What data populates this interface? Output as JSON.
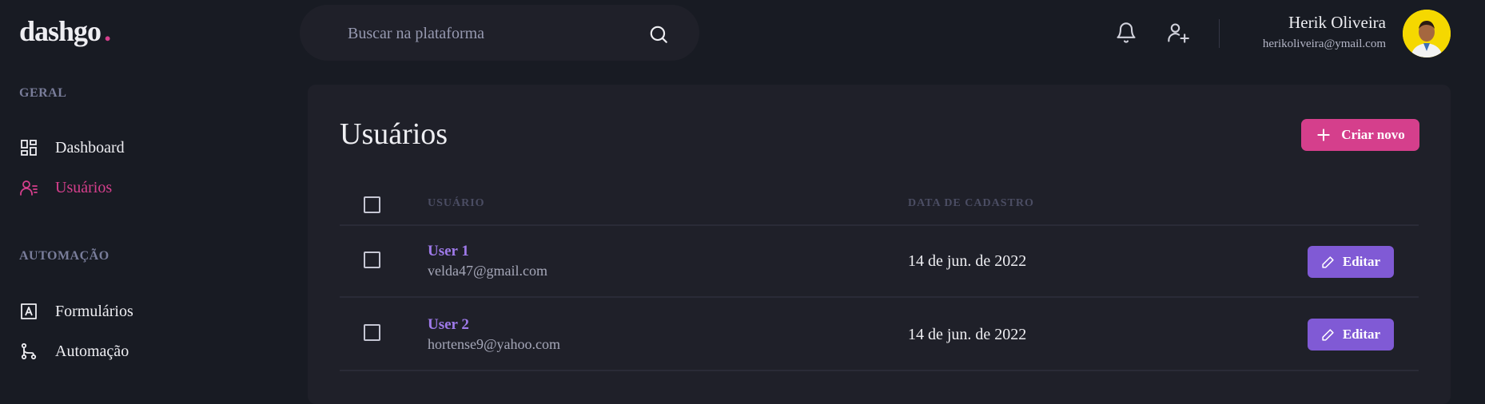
{
  "logo": {
    "text": "dashgo",
    "dot": "."
  },
  "search": {
    "placeholder": "Buscar na plataforma",
    "icon": "search-icon"
  },
  "header": {
    "icons": [
      "bell-icon",
      "user-add-icon"
    ],
    "user": {
      "name": "Herik Oliveira",
      "email": "herikoliveira@ymail.com"
    }
  },
  "sidebar": {
    "sections": [
      {
        "title": "GERAL",
        "items": [
          {
            "label": "Dashboard",
            "icon": "dashboard-icon",
            "active": false
          },
          {
            "label": "Usuários",
            "icon": "users-icon",
            "active": true
          }
        ]
      },
      {
        "title": "AUTOMAÇÃO",
        "items": [
          {
            "label": "Formulários",
            "icon": "form-icon",
            "active": false
          },
          {
            "label": "Automação",
            "icon": "git-branch-icon",
            "active": false
          }
        ]
      }
    ]
  },
  "main": {
    "title": "Usuários",
    "create_button": "Criar novo",
    "columns": [
      "USUÁRIO",
      "DATA DE CADASTRO"
    ],
    "rows": [
      {
        "name": "User 1",
        "email": "velda47@gmail.com",
        "date": "14 de jun. de 2022",
        "action": "Editar"
      },
      {
        "name": "User 2",
        "email": "hortense9@yahoo.com",
        "date": "14 de jun. de 2022",
        "action": "Editar"
      }
    ]
  },
  "colors": {
    "background": "#181B23",
    "panel": "#1F2029",
    "accent_pink": "#D53F8C",
    "accent_purple": "#805AD5",
    "link_purple": "#9F7AEA"
  }
}
